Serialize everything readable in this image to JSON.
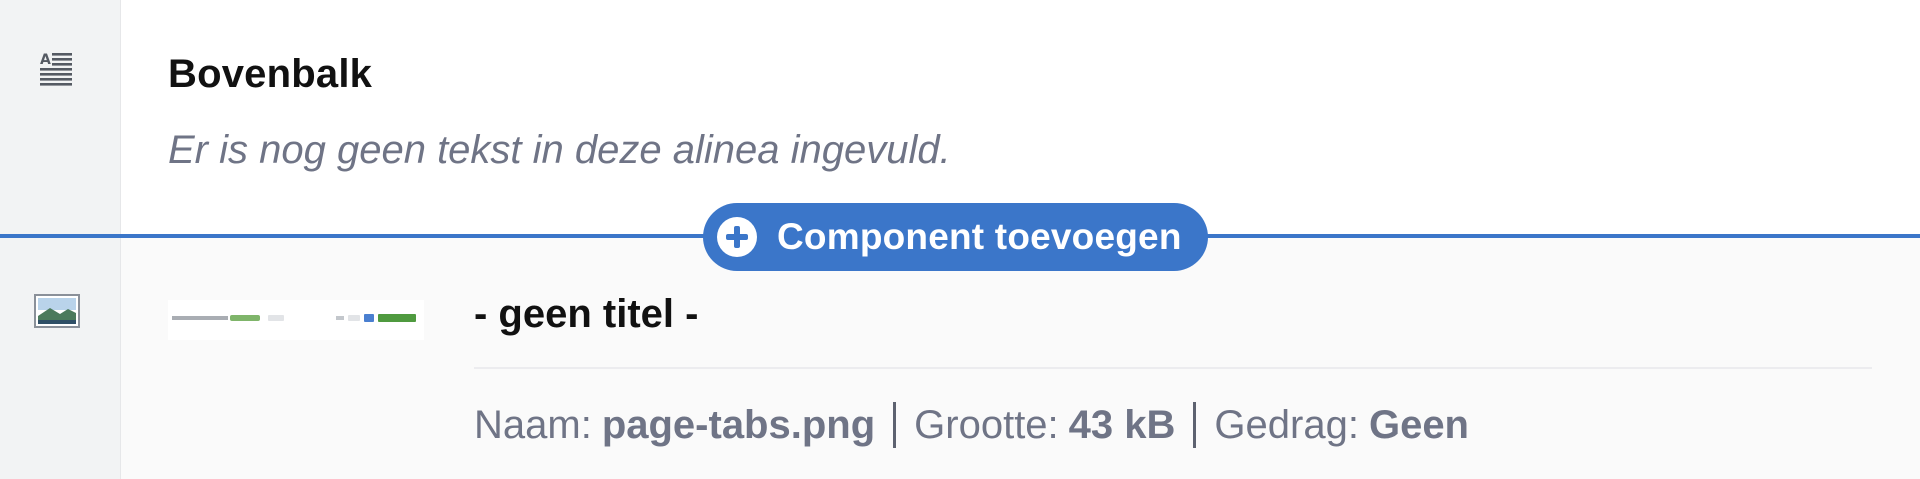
{
  "paragraph_component": {
    "icon": "text-paragraph-icon",
    "heading": "Bovenbalk",
    "placeholder_text": "Er is nog geen tekst in deze alinea ingevuld."
  },
  "insert": {
    "button_label": "Component toevoegen",
    "icon": "plus-circle-icon",
    "accent_color": "#3b76c9"
  },
  "image_component": {
    "icon": "image-icon",
    "title": "- geen titel -",
    "meta": {
      "name_label": "Naam:",
      "name_value": "page-tabs.png",
      "size_label": "Grootte:",
      "size_value": "43 kB",
      "behavior_label": "Gedrag:",
      "behavior_value": "Geen"
    }
  }
}
